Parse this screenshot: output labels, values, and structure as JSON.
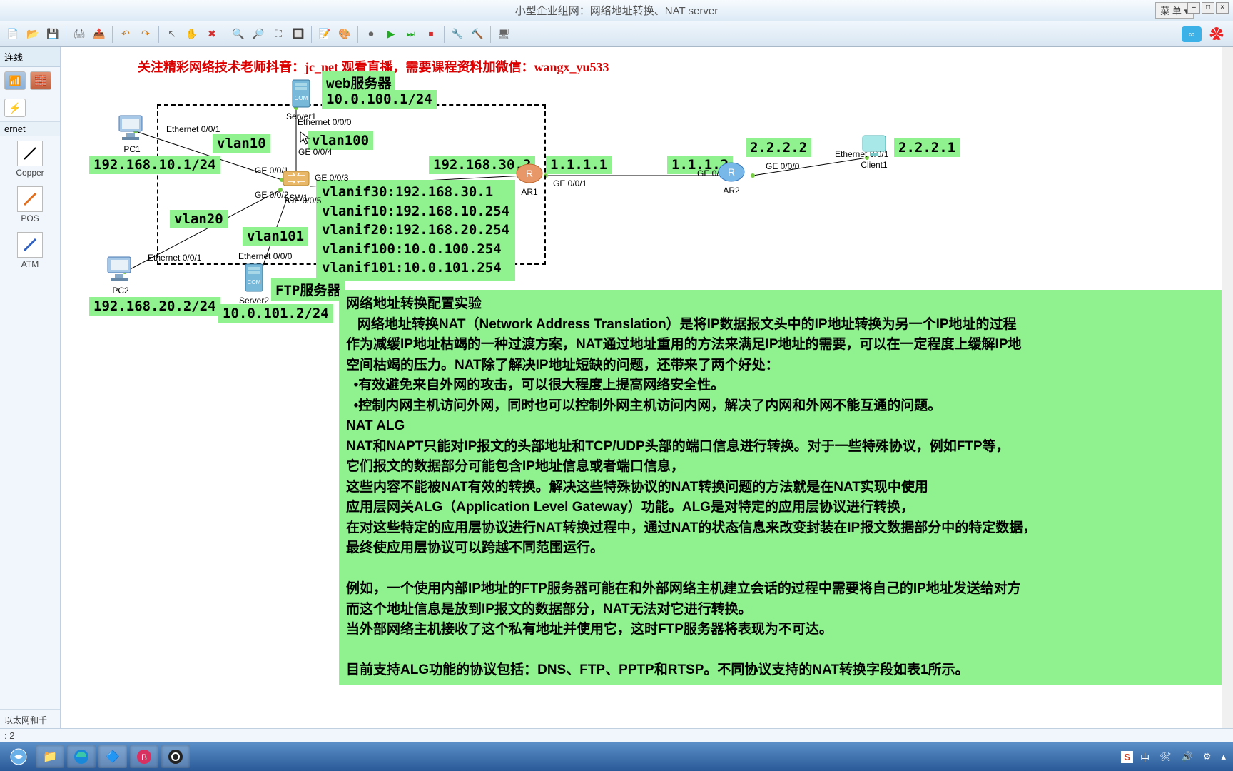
{
  "window": {
    "title": "小型企业组网：网络地址转换、NAT server",
    "menu": "菜 单"
  },
  "leftpanel": {
    "header": "连线",
    "cat_internet": "ernet",
    "tools": [
      {
        "label": "Copper"
      },
      {
        "label": "POS"
      },
      {
        "label": "ATM"
      }
    ],
    "desc": "以太网和千\n。"
  },
  "banner": "关注精彩网络技术老师抖音：jc_net 观看直播，需要课程资料加微信：wangx_yu533",
  "labels": {
    "web_server": "web服务器",
    "web_ip": "10.0.100.1/24",
    "vlan10": "vlan10",
    "vlan100": "vlan100",
    "vlan20": "vlan20",
    "vlan101": "vlan101",
    "pc1_ip": "192.168.10.1/24",
    "pc2_ip": "192.168.20.2/24",
    "lsw_ip": "192.168.30.2",
    "ar1_left": "1.1.1.1",
    "ar2_left": "1.1.1.2",
    "ar2_right": "2.2.2.2",
    "client_ip": "2.2.2.1",
    "ftp_server": "FTP服务器",
    "ftp_ip": "10.0.101.2/24"
  },
  "devices": {
    "pc1": "PC1",
    "pc2": "PC2",
    "server1": "Server1",
    "server2": "Server2",
    "lsw1": "LSW1",
    "ar1": "AR1",
    "ar2": "AR2",
    "client1": "Client1"
  },
  "ports": {
    "eth001_a": "Ethernet 0/0/1",
    "eth000": "Ethernet 0/0/0",
    "ge001": "GE 0/0/1",
    "ge002": "GE 0/0/2",
    "ge003": "GE 0/0/3",
    "ge004": "GE 0/0/4",
    "ge005": "GE 0/0/5",
    "ge001_r": "GE 0/0/1",
    "ge000_r": "GE 0/0/0",
    "ge001_ar2": "GE 0/0/1"
  },
  "vlanif": "vlanif30:192.168.30.1\nvlanif10:192.168.10.254\nvlanif20:192.168.20.254\nvlanif100:10.0.100.254\nvlanif101:10.0.101.254",
  "desc": {
    "title": "网络地址转换配置实验",
    "p1": "   网络地址转换NAT（Network Address Translation）是将IP数据报文头中的IP地址转换为另一个IP地址的过程",
    "p2": "作为减缓IP地址枯竭的一种过渡方案，NAT通过地址重用的方法来满足IP地址的需要，可以在一定程度上缓解IP地",
    "p3": "空间枯竭的压力。NAT除了解决IP地址短缺的问题，还带来了两个好处：",
    "b1": "  •有效避免来自外网的攻击，可以很大程度上提高网络安全性。",
    "b2": "  •控制内网主机访问外网，同时也可以控制外网主机访问内网，解决了内网和外网不能互通的问题。",
    "h2": "NAT ALG",
    "p4": "NAT和NAPT只能对IP报文的头部地址和TCP/UDP头部的端口信息进行转换。对于一些特殊协议，例如FTP等，",
    "p5": "它们报文的数据部分可能包含IP地址信息或者端口信息，",
    "p6": "这些内容不能被NAT有效的转换。解决这些特殊协议的NAT转换问题的方法就是在NAT实现中使用",
    "p7": "应用层网关ALG（Application Level Gateway）功能。ALG是对特定的应用层协议进行转换，",
    "p8": "在对这些特定的应用层协议进行NAT转换过程中，通过NAT的状态信息来改变封装在IP报文数据部分中的特定数据，",
    "p9": "最终使应用层协议可以跨越不同范围运行。",
    "p10": "例如，一个使用内部IP地址的FTP服务器可能在和外部网络主机建立会话的过程中需要将自己的IP地址发送给对方",
    "p11": "而这个地址信息是放到IP报文的数据部分，NAT无法对它进行转换。",
    "p12": "当外部网络主机接收了这个私有地址并使用它，这时FTP服务器将表现为不可达。",
    "p13": "目前支持ALG功能的协议包括：DNS、FTP、PPTP和RTSP。不同协议支持的NAT转换字段如表1所示。"
  },
  "status": ": 2",
  "tray": {
    "ime": "S",
    "lang": "中"
  }
}
